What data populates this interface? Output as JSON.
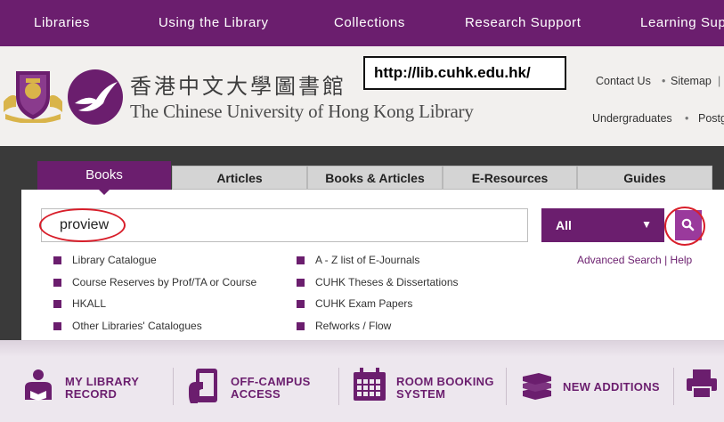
{
  "topnav": {
    "items": [
      "Libraries",
      "Using the Library",
      "Collections",
      "Research Support",
      "Learning Sup"
    ]
  },
  "header": {
    "library_name_cn": "香港中文大學圖書館",
    "library_name_en": "The Chinese University of Hong Kong Library",
    "url_annotation": "http://lib.cuhk.edu.hk/",
    "utility_links": [
      "Contact Us",
      "Sitemap"
    ],
    "utility_separator_dot": "•",
    "utility_separator_bar": "|",
    "audience_links": [
      "Undergraduates",
      "Postg"
    ]
  },
  "search": {
    "tabs": [
      "Books",
      "Articles",
      "Books & Articles",
      "E-Resources",
      "Guides"
    ],
    "active_tab": "Books",
    "query": "proview",
    "scope": "All",
    "scope_caret": "▼",
    "advanced_label": "Advanced Search",
    "help_label": "Help",
    "separator": "|",
    "links_left": [
      "Library Catalogue",
      "Course Reserves by Prof/TA or Course",
      "HKALL",
      "Other Libraries' Catalogues"
    ],
    "links_right": [
      "A - Z list of E-Journals",
      "CUHK Theses & Dissertations",
      "CUHK Exam Papers",
      "Refworks / Flow"
    ]
  },
  "quick_links": [
    {
      "line1": "MY LIBRARY",
      "line2": "RECORD"
    },
    {
      "line1": "OFF-CAMPUS",
      "line2": "ACCESS"
    },
    {
      "line1": "ROOM BOOKING",
      "line2": "SYSTEM"
    },
    {
      "line1": "NEW ADDITIONS",
      "line2": ""
    }
  ],
  "colors": {
    "brand_purple": "#6b1e6e",
    "annotation_red": "#d81e2a",
    "dark_band": "#3a3a3a"
  },
  "icons": [
    "university-crest-icon",
    "library-bird-logo-icon",
    "search-icon",
    "library-record-icon",
    "mobile-access-icon",
    "calendar-icon",
    "books-stack-icon",
    "printer-icon"
  ]
}
